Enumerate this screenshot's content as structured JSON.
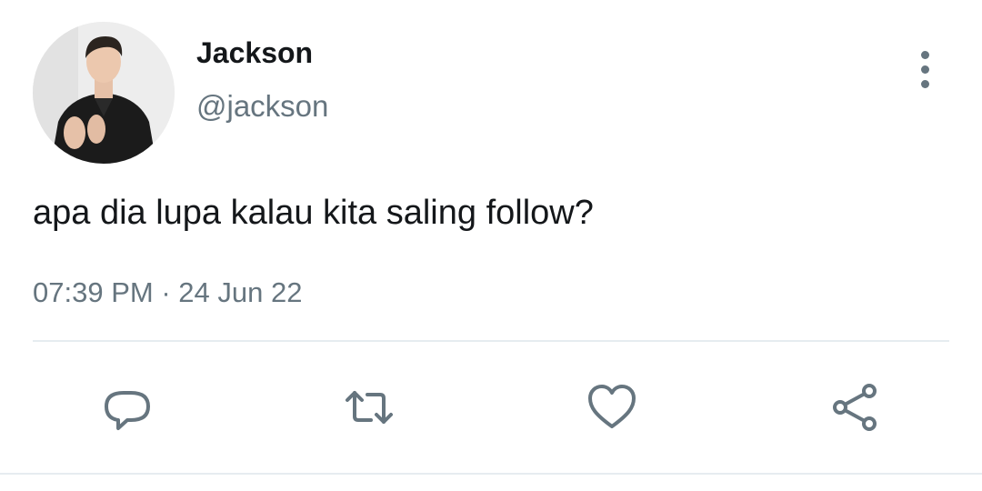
{
  "tweet": {
    "author": {
      "display_name": "Jackson",
      "handle": "@jackson",
      "avatar_icon": "profile-photo"
    },
    "text": "apa dia lupa kalau kita saling follow?",
    "time": "07:39 PM",
    "separator": "·",
    "date": "24 Jun 22"
  },
  "actions": [
    {
      "name": "reply",
      "icon": "speech-bubble-icon"
    },
    {
      "name": "retweet",
      "icon": "retweet-icon"
    },
    {
      "name": "like",
      "icon": "heart-icon"
    },
    {
      "name": "share",
      "icon": "share-icon"
    }
  ],
  "colors": {
    "text_primary": "#14171a",
    "text_secondary": "#66757f",
    "divider": "#e6ecf0"
  }
}
